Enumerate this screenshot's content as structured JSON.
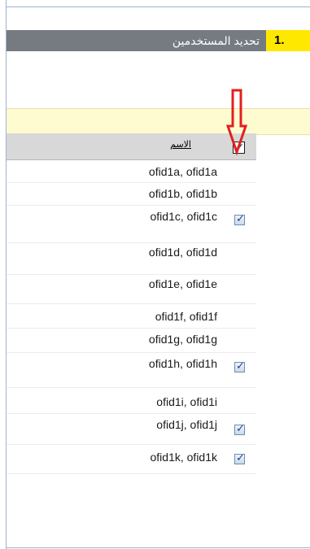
{
  "step": {
    "number": "1.",
    "title": "تحديد المستخدمين"
  },
  "table": {
    "name_header": "الاسم",
    "select_all_checked": true,
    "rows": [
      {
        "name": "ofid1a, ofid1a",
        "checked": false
      },
      {
        "name": "ofid1b, ofid1b",
        "checked": false
      },
      {
        "name": "ofid1c, ofid1c",
        "checked": true
      },
      {
        "name": "ofid1d, ofid1d",
        "checked": false
      },
      {
        "name": "ofid1e, ofid1e",
        "checked": false
      },
      {
        "name": "ofid1f, ofid1f",
        "checked": false
      },
      {
        "name": "ofid1g, ofid1g",
        "checked": false
      },
      {
        "name": "ofid1h, ofid1h",
        "checked": true
      },
      {
        "name": "ofid1i, ofid1i",
        "checked": false
      },
      {
        "name": "ofid1j, ofid1j",
        "checked": true
      },
      {
        "name": "ofid1k, ofid1k",
        "checked": true
      }
    ]
  },
  "colors": {
    "header_bar": "#767b82",
    "step_badge": "#ffe800",
    "callout_arrow": "#e02020",
    "highlight_band": "#fffbd1"
  },
  "annotation": {
    "arrow_icon": "down-arrow-outline-icon"
  }
}
